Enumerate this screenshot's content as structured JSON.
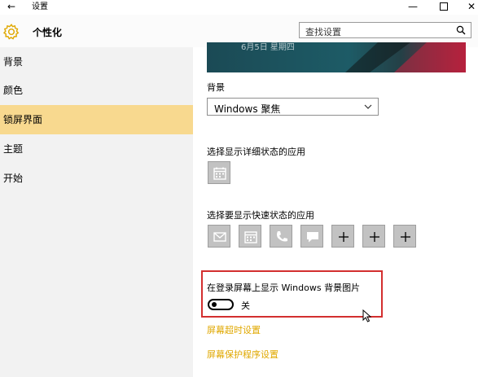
{
  "window": {
    "back_glyph": "←",
    "title": "设置",
    "minimize_glyph": "—",
    "close_glyph": "✕"
  },
  "header": {
    "title": "个性化",
    "icon": "gear-icon",
    "search_placeholder": "查找设置",
    "search_icon": "search-icon"
  },
  "sidebar": {
    "items": [
      {
        "label": "背景",
        "selected": false
      },
      {
        "label": "颜色",
        "selected": false
      },
      {
        "label": "锁屏界面",
        "selected": true
      },
      {
        "label": "主题",
        "selected": false
      },
      {
        "label": "开始",
        "selected": false
      }
    ]
  },
  "main": {
    "preview_caption": "6月5日 星期四",
    "background_label": "背景",
    "background_value": "Windows 聚焦",
    "detailed_status_label": "选择显示详细状态的应用",
    "detailed_status_app": "calendar-icon",
    "quick_status_label": "选择要显示快速状态的应用",
    "quick_status_apps": [
      "mail-icon",
      "calendar-icon",
      "phone-icon",
      "message-icon",
      "plus-icon",
      "plus-icon",
      "plus-icon"
    ],
    "plus_glyph": "+",
    "toggle_label": "在登录屏幕上显示 Windows 背景图片",
    "toggle_state": "关",
    "toggle_on": false,
    "link_timeout": "屏幕超时设置",
    "link_screensaver": "屏幕保护程序设置"
  },
  "colors": {
    "accent": "#f8d98f",
    "link": "#e0a800",
    "highlight_box": "#d32f2f"
  }
}
